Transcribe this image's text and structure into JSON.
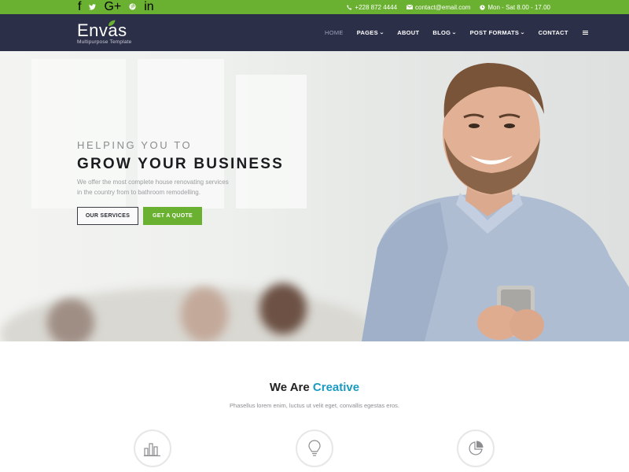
{
  "topbar": {
    "social": [
      "f",
      "t",
      "G+",
      "p",
      "in"
    ],
    "social_icons": [
      "facebook-icon",
      "twitter-icon",
      "google-plus-icon",
      "pinterest-icon",
      "linkedin-icon"
    ],
    "phone": "+228 872 4444",
    "email": "contact@email.com",
    "hours": "Mon - Sat 8.00 - 17.00"
  },
  "brand": {
    "name": "Envas",
    "tagline": "Multipurpose Template"
  },
  "nav": {
    "items": [
      {
        "label": "HOME",
        "active": true,
        "dropdown": false
      },
      {
        "label": "PAGES",
        "active": false,
        "dropdown": true
      },
      {
        "label": "ABOUT",
        "active": false,
        "dropdown": false
      },
      {
        "label": "BLOG",
        "active": false,
        "dropdown": true
      },
      {
        "label": "POST FORMATS",
        "active": false,
        "dropdown": true
      },
      {
        "label": "CONTACT",
        "active": false,
        "dropdown": false
      }
    ],
    "menu_icon": "hamburger-icon"
  },
  "hero": {
    "subtitle": "HELPING YOU TO",
    "title": "GROW YOUR BUSINESS",
    "description": "We offer the most complete house renovating services in the country from to bathroom remodelling.",
    "button_primary": "OUR SERVICES",
    "button_secondary": "GET A QUOTE"
  },
  "section": {
    "title_pre": "We Are ",
    "title_highlight": "Creative",
    "subtitle": "Phasellus lorem enim, luctus ut velit eget, convallis egestas eros.",
    "icons": [
      "bar-chart-icon",
      "lightbulb-icon",
      "pie-chart-icon"
    ]
  },
  "colors": {
    "accent_green": "#6bb131",
    "nav_bg": "#2b2f48",
    "highlight_blue": "#1a9ac0"
  }
}
